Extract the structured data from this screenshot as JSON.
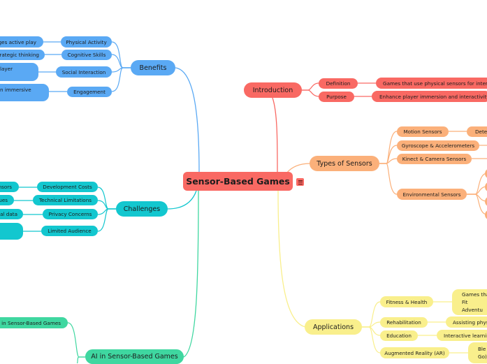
{
  "central": {
    "label": "Sensor-Based Games",
    "menu_icon": "list-icon"
  },
  "colors": {
    "central": "#f96963",
    "introduction": "#f96963",
    "types_of_sensors": "#fbb07a",
    "applications": "#f9ef8c",
    "benefits": "#5aa9f4",
    "challenges": "#13c7cf",
    "ai": "#3fd7a0"
  },
  "introduction": {
    "label": "Introduction",
    "children": [
      {
        "label": "Definition",
        "detail": "Games that use physical sensors for interaction"
      },
      {
        "label": "Purpose",
        "detail": "Enhance player immersion and interactivity"
      }
    ]
  },
  "types_of_sensors": {
    "label": "Types of Sensors",
    "children": [
      {
        "label": "Motion Sensors",
        "detail": "Detec"
      },
      {
        "label": "Gyroscope & Accelerometers",
        "detail": ""
      },
      {
        "label": "Kinect & Camera Sensors",
        "detail": ""
      },
      {
        "label": "Environmental Sensors",
        "detail": ""
      }
    ]
  },
  "applications": {
    "label": "Applications",
    "children": [
      {
        "label": "Fitness & Health",
        "detail": "Games tha Fit Adventu"
      },
      {
        "label": "Rehabilitation",
        "detail": "Assisting phys"
      },
      {
        "label": "Education",
        "detail": "Interactive learnin"
      },
      {
        "label": "Augmented Reality (AR)",
        "detail": "Ble Go)"
      }
    ]
  },
  "benefits": {
    "label": "Benefits",
    "children": [
      {
        "label": "Physical Activity",
        "detail": "ges active play"
      },
      {
        "label": "Cognitive Skills",
        "detail": "rategic thinking"
      },
      {
        "label": "Social Interaction",
        "detail": "layer"
      },
      {
        "label": "Engagement",
        "detail": "n immersive"
      }
    ]
  },
  "challenges": {
    "label": "Challenges",
    "children": [
      {
        "label": "Development Costs",
        "detail": "nsors"
      },
      {
        "label": "Technical Limitations",
        "detail": "ues"
      },
      {
        "label": "Privacy Concerns",
        "detail": "tal data"
      },
      {
        "label": "Limited Audience",
        "detail": ""
      }
    ]
  },
  "ai": {
    "label": "AI in Sensor-Based Games",
    "children": [
      {
        "label": "l in Sensor-Based Games"
      }
    ]
  }
}
